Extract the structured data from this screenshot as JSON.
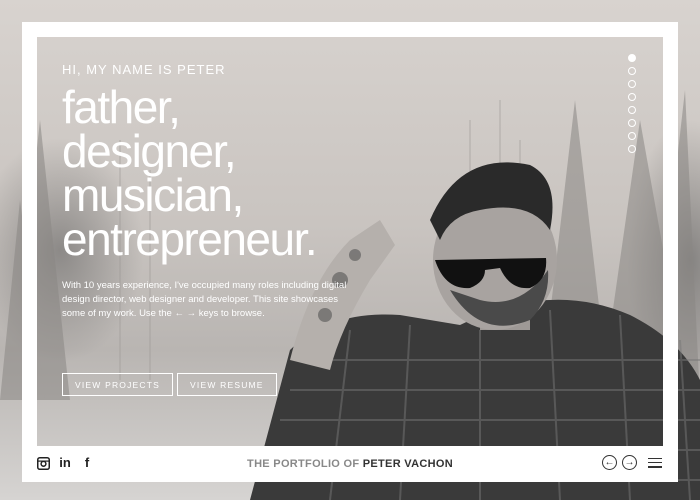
{
  "hero": {
    "greeting": "HI, MY NAME IS PETER",
    "roles": [
      "father,",
      "designer,",
      "musician,",
      "entrepreneur."
    ],
    "intro": "With 10 years experience, I've occupied many roles including digital design director, web designer and developer. This site showcases some of my work. Use the ← → keys to browse.",
    "buttons": {
      "projects": "VIEW PROJECTS",
      "resume": "VIEW RESUME"
    }
  },
  "footer": {
    "title_lead": "THE PORTFOLIO OF",
    "title_name": "PETER VACHON",
    "social": [
      {
        "icon": "instagram-icon"
      },
      {
        "icon": "linkedin-icon",
        "glyph": "in"
      },
      {
        "icon": "facebook-icon",
        "glyph": "f"
      }
    ],
    "prev_glyph": "←",
    "next_glyph": "→"
  },
  "slides": {
    "count": 8,
    "active_index": 0
  },
  "colors": {
    "frame": "#ffffff",
    "text_light": "#ffffff",
    "text_dark": "#333333"
  }
}
